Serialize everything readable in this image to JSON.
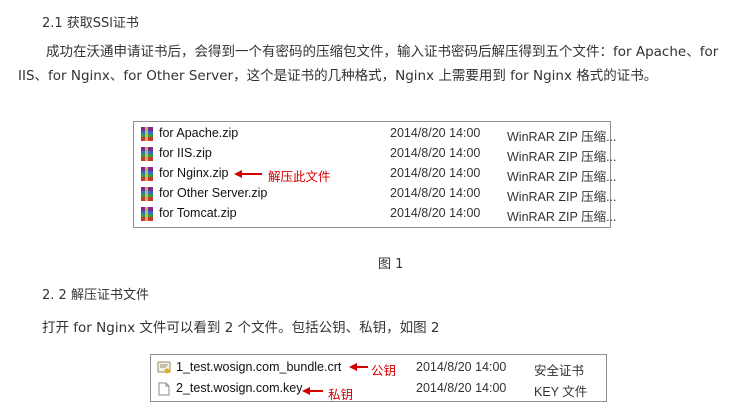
{
  "section1": {
    "heading": "2.1 获取SSl证书",
    "paragraph": "成功在沃通申请证书后，会得到一个有密码的压缩包文件，输入证书密码后解压得到五个文件：for Apache、for IIS、for Nginx、for Other Server，这个是证书的几种格式，Nginx 上需要用到 for Nginx 格式的证书。"
  },
  "figure1": {
    "files": [
      {
        "name": "for Apache.zip",
        "date": "2014/8/20 14:00",
        "type": "WinRAR ZIP 压缩..."
      },
      {
        "name": "for IIS.zip",
        "date": "2014/8/20 14:00",
        "type": "WinRAR ZIP 压缩..."
      },
      {
        "name": "for Nginx.zip",
        "date": "2014/8/20 14:00",
        "type": "WinRAR ZIP 压缩..."
      },
      {
        "name": "for Other Server.zip",
        "date": "2014/8/20 14:00",
        "type": "WinRAR ZIP 压缩..."
      },
      {
        "name": "for Tomcat.zip",
        "date": "2014/8/20 14:00",
        "type": "WinRAR ZIP 压缩..."
      }
    ],
    "annotation": "解压此文件",
    "caption": "图 1"
  },
  "section2": {
    "heading": "2. 2 解压证书文件",
    "paragraph": "打开 for Nginx 文件可以看到 2 个文件。包括公钥、私钥，如图 2"
  },
  "figure2": {
    "files": [
      {
        "name": "1_test.wosign.com_bundle.crt",
        "date": "2014/8/20 14:00",
        "type": "安全证书"
      },
      {
        "name": "2_test.wosign.com.key",
        "date": "2014/8/20 14:00",
        "type": "KEY 文件"
      }
    ],
    "annotation_public": "公钥",
    "annotation_private": "私钥"
  },
  "colors": {
    "annotation": "#d40000",
    "text": "#333333"
  }
}
